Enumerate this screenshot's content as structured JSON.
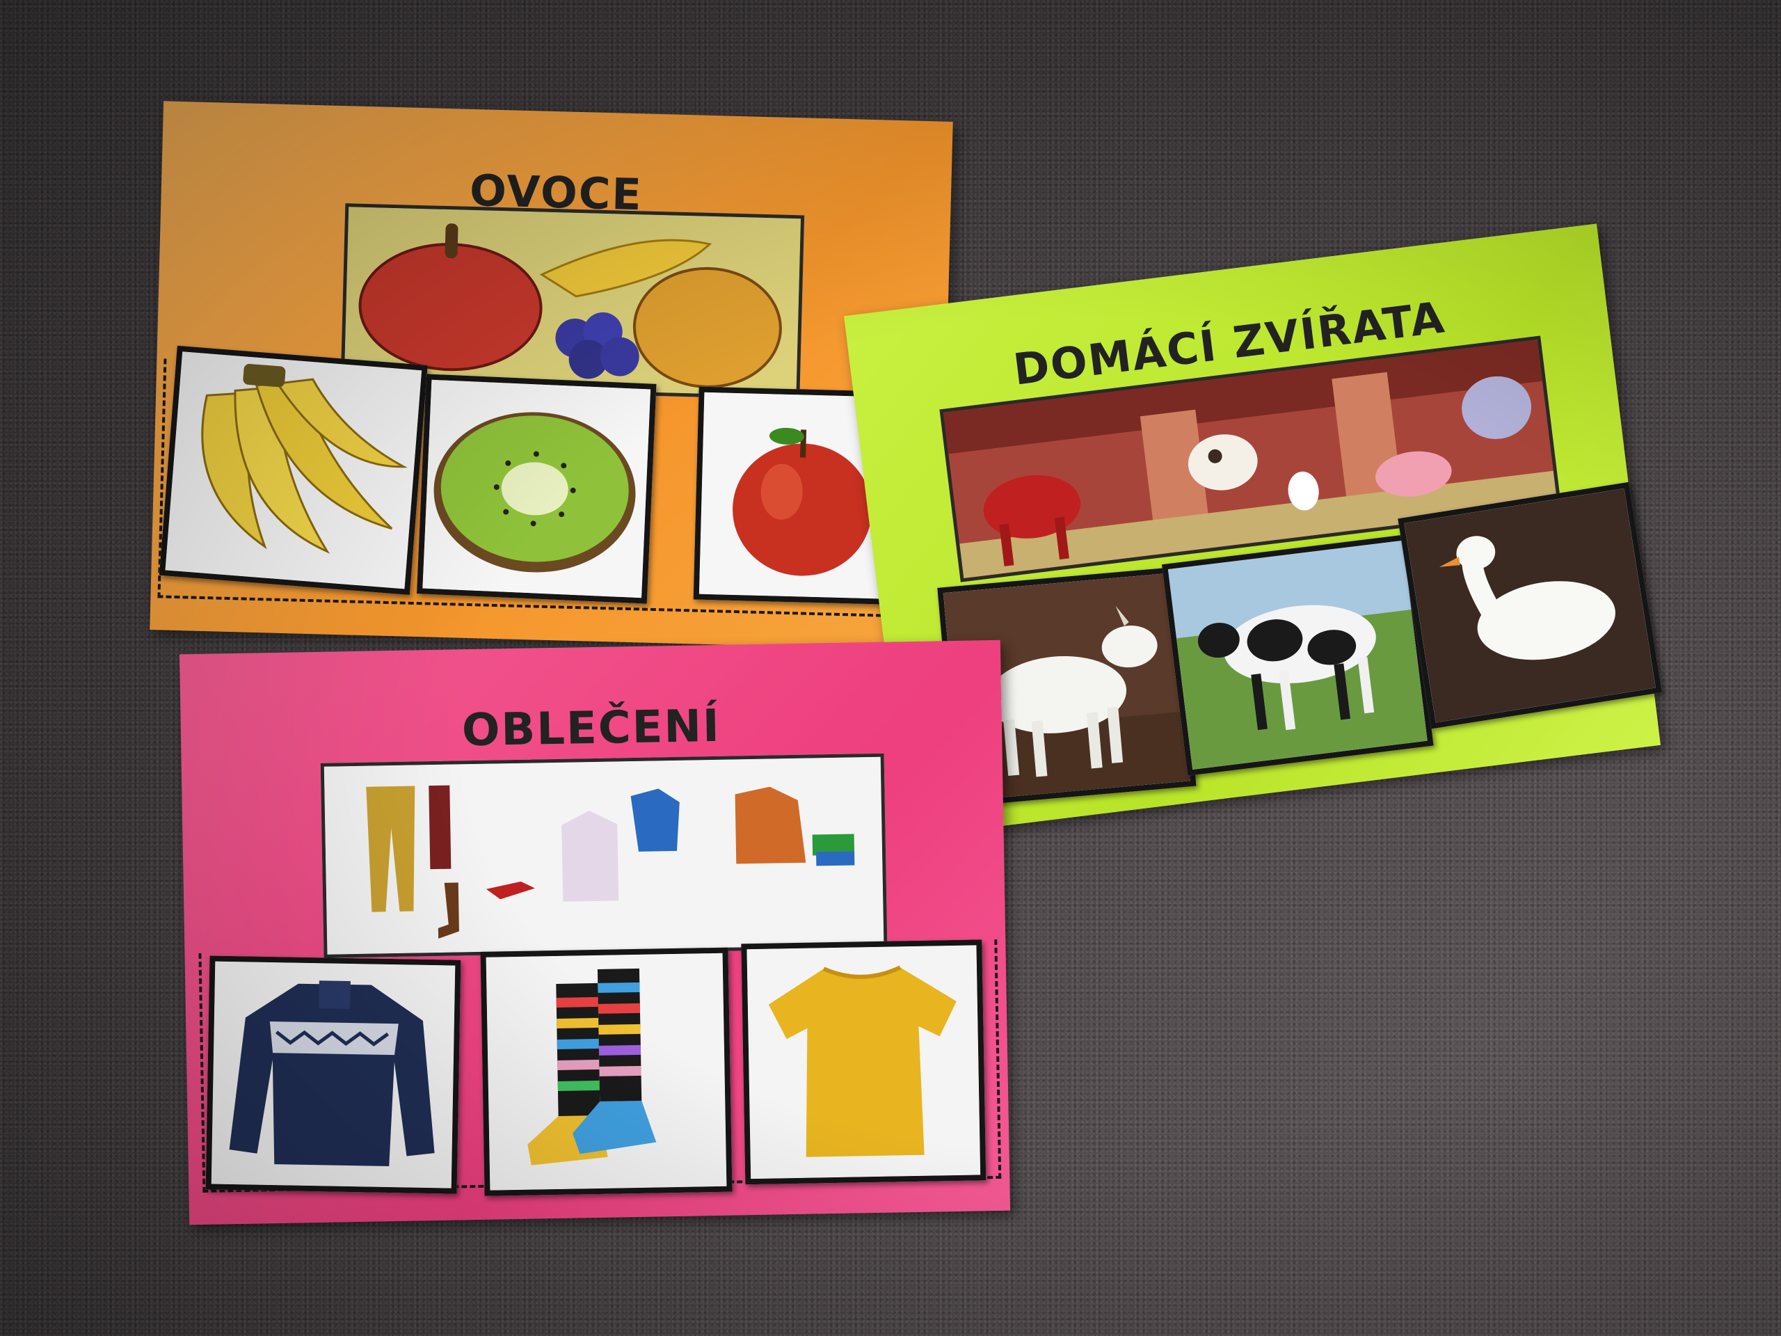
{
  "boards": {
    "fruit": {
      "title": "OVOCE",
      "color": "#f7a23d"
    },
    "animals": {
      "title": "DOMÁCÍ ZVÍŘATA",
      "color": "#c9f02e"
    },
    "clothes": {
      "title": "OBLEČENÍ",
      "color": "#f04a86"
    }
  },
  "cards": {
    "fruit": [
      "banana-picture",
      "kiwi-picture",
      "apple-picture"
    ],
    "animals": [
      "goat-picture",
      "cow-picture",
      "goose-picture"
    ],
    "clothes": [
      "sweater-picture",
      "striped-socks-picture",
      "yellow-tshirt-picture"
    ]
  },
  "colors": {
    "carpet": "#4a4446",
    "card_border": "#151515"
  }
}
